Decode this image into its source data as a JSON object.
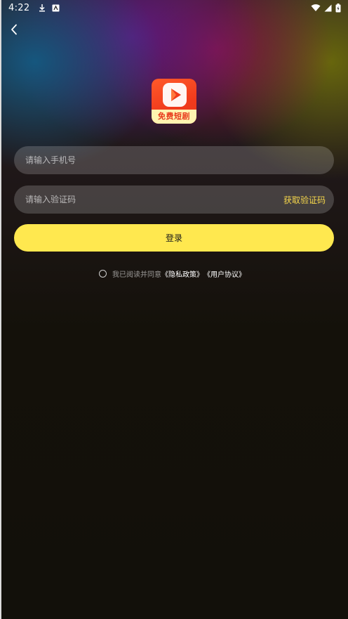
{
  "status_bar": {
    "time": "4:22"
  },
  "logo": {
    "banner_text": "免费短剧"
  },
  "form": {
    "phone_placeholder": "请输入手机号",
    "code_placeholder": "请输入验证码",
    "get_code_label": "获取验证码",
    "login_label": "登录"
  },
  "agreement": {
    "prefix": "我已阅读并同意",
    "privacy_link": "《隐私政策》",
    "terms_link": "《用户协议》"
  },
  "colors": {
    "accent_yellow": "#ffe84f",
    "link_yellow": "#f5d64b",
    "logo_red": "#f03a1c"
  }
}
